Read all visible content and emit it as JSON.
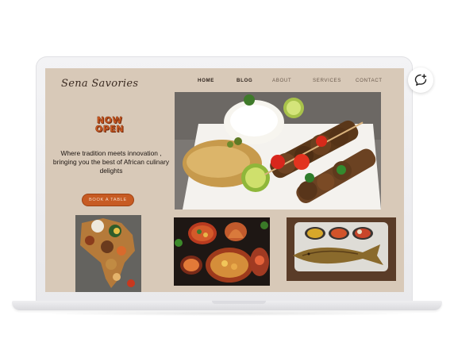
{
  "site": {
    "logo_text": "Sena Savories",
    "nav": [
      {
        "label": "HOME",
        "active": true
      },
      {
        "label": "BLOG",
        "active": true
      },
      {
        "label": "ABOUT",
        "active": false
      },
      {
        "label": "SERVICES",
        "active": false
      },
      {
        "label": "CONTACT",
        "active": false
      }
    ],
    "hero": {
      "badge_line1": "NOW",
      "badge_line2": "OPEN",
      "tagline": "Where tradition meets innovation , bringing you the best of African culinary delights",
      "cta_label": "BOOK A TABLE"
    }
  },
  "colors": {
    "screen_bg": "#d8c9b8",
    "accent": "#c75b23",
    "text_dark": "#1e1713"
  },
  "icons": {
    "chat": "chat-plus-icon"
  }
}
